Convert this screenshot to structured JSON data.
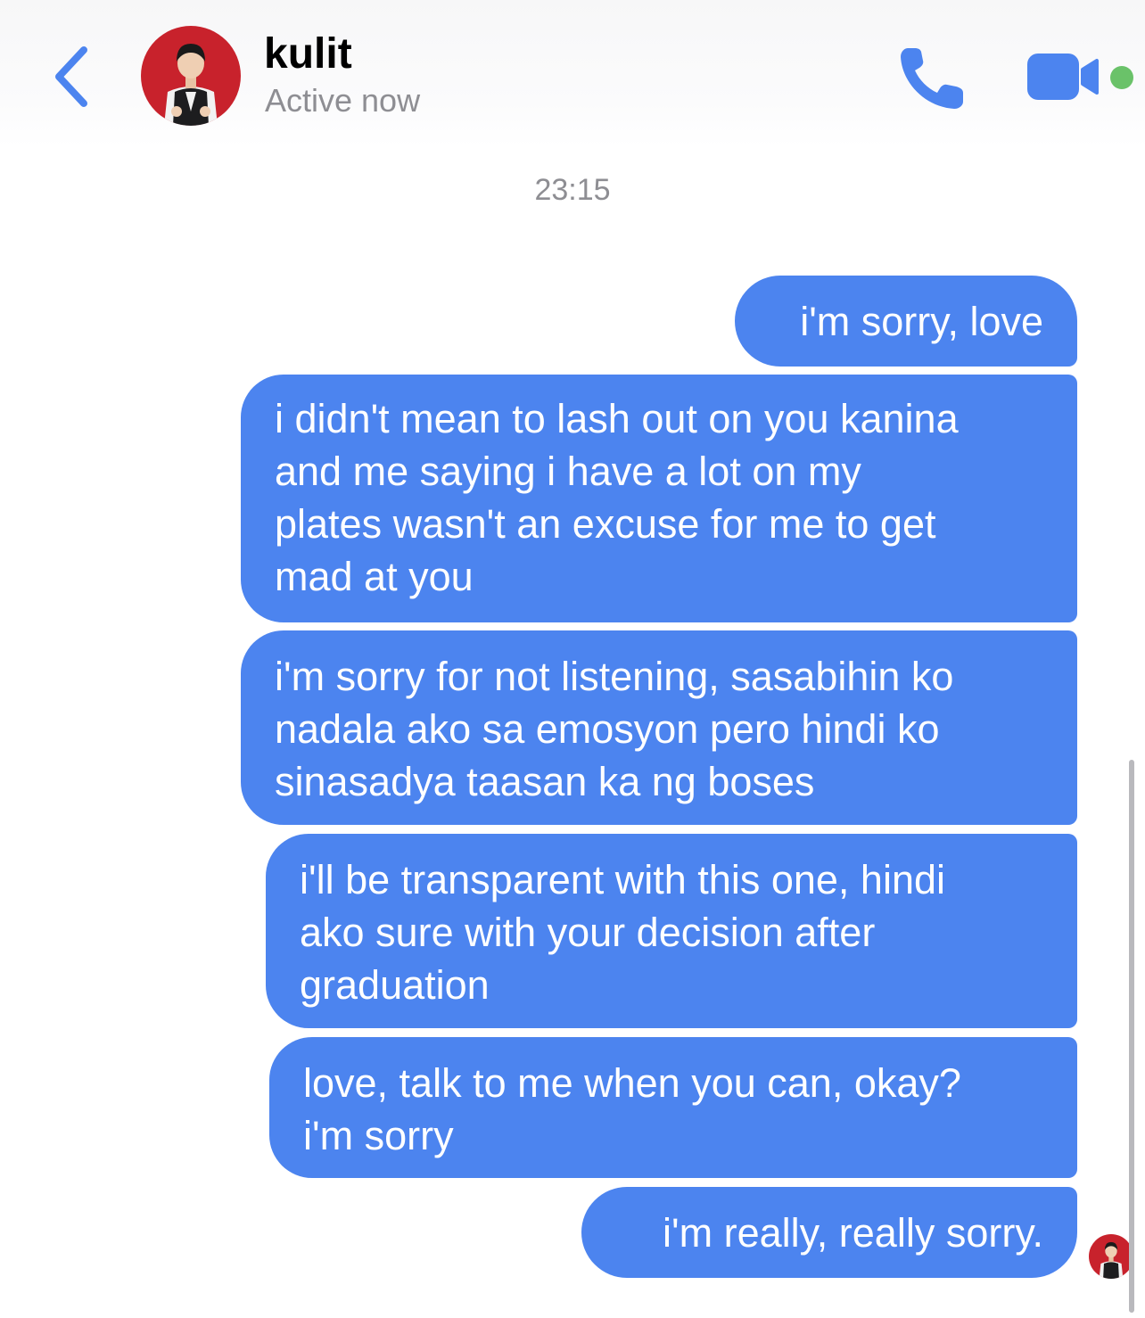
{
  "header": {
    "contact_name": "kulit",
    "status": "Active now",
    "icons": {
      "back": "chevron-left-icon",
      "call": "phone-icon",
      "video": "video-camera-icon",
      "presence": "active-status-dot"
    },
    "colors": {
      "accent": "#4c84ef",
      "active_dot": "#6ac269",
      "status_text": "#8e8e93",
      "avatar_bg": "#c8222c"
    }
  },
  "conversation": {
    "timestamp": "23:15",
    "messages": [
      {
        "sender": "me",
        "text": "i'm sorry, love"
      },
      {
        "sender": "me",
        "text": "i didn't mean to lash out on you kanina\nand me saying i have a lot on my\nplates wasn't an excuse for me to get\nmad at you"
      },
      {
        "sender": "me",
        "text": "i'm sorry for not listening, sasabihin ko\nnadala ako sa emosyon pero hindi ko\nsinasadya taasan ka ng boses"
      },
      {
        "sender": "me",
        "text": "i'll be transparent with this one, hindi\nako sure with your decision after\ngraduation"
      },
      {
        "sender": "me",
        "text": "love, talk to me when you can, okay?\ni'm sorry"
      },
      {
        "sender": "me",
        "text": "i'm really, really sorry."
      }
    ],
    "bubble_color": "#4c84ef",
    "bubble_text_color": "#ffffff"
  }
}
